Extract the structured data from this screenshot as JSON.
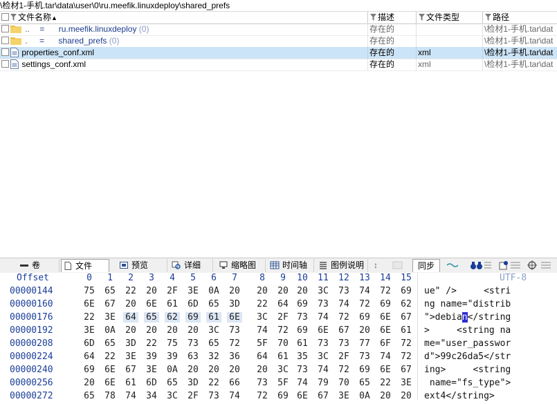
{
  "path_bar": "\\检材1-手机.tar\\data\\user\\0\\ru.meefik.linuxdeploy\\shared_prefs",
  "file_list": {
    "columns": {
      "name": "文件名称",
      "sort_indicator": "▲",
      "desc": "描述",
      "type": "文件类型",
      "path": "路径"
    },
    "rows": [
      {
        "kind": "folder",
        "dots": "..",
        "eq": "=",
        "name": "ru.meefik.linuxdeploy",
        "count": "(0)",
        "desc": "存在的",
        "type": "",
        "path": "\\检材1-手机.tar\\dat",
        "selected": false
      },
      {
        "kind": "folder",
        "dots": ".",
        "eq": "=",
        "name": "shared_prefs",
        "count": "(0)",
        "desc": "存在的",
        "type": "",
        "path": "\\检材1-手机.tar\\dat",
        "selected": false
      },
      {
        "kind": "file",
        "dots": "",
        "eq": "",
        "name": "properties_conf.xml",
        "count": "",
        "desc": "存在的",
        "type": "xml",
        "path": "\\检材1-手机.tar\\dat",
        "selected": true
      },
      {
        "kind": "file",
        "dots": "",
        "eq": "",
        "name": "settings_conf.xml",
        "count": "",
        "desc": "存在的",
        "type": "xml",
        "path": "\\检材1-手机.tar\\dat",
        "selected": false
      }
    ]
  },
  "toolbar": {
    "tabs": [
      {
        "label": "卷",
        "icon": "volume-icon"
      },
      {
        "label": "文件",
        "icon": "file-icon"
      },
      {
        "label": "预览",
        "icon": "preview-icon"
      },
      {
        "label": "详细",
        "icon": "detail-icon"
      },
      {
        "label": "缩略图",
        "icon": "thumbnail-icon"
      },
      {
        "label": "时间轴",
        "icon": "timeline-icon"
      },
      {
        "label": "图例说明",
        "icon": "legend-icon"
      }
    ],
    "sync_label": "同步"
  },
  "hex": {
    "offset_label": "Offset",
    "columns": [
      "0",
      "1",
      "2",
      "3",
      "4",
      "5",
      "6",
      "7",
      "8",
      "9",
      "10",
      "11",
      "12",
      "13",
      "14",
      "15"
    ],
    "encoding": "UTF-8",
    "rows": [
      {
        "offset": "00000144",
        "bytes": [
          "75",
          "65",
          "22",
          "20",
          "2F",
          "3E",
          "0A",
          "20",
          "20",
          "20",
          "20",
          "3C",
          "73",
          "74",
          "72",
          "69"
        ],
        "text": "ue\" />     <stri"
      },
      {
        "offset": "00000160",
        "bytes": [
          "6E",
          "67",
          "20",
          "6E",
          "61",
          "6D",
          "65",
          "3D",
          "22",
          "64",
          "69",
          "73",
          "74",
          "72",
          "69",
          "62"
        ],
        "text": "ng name=\"distrib"
      },
      {
        "offset": "00000176",
        "bytes": [
          "22",
          "3E",
          "64",
          "65",
          "62",
          "69",
          "61",
          "6E",
          "3C",
          "2F",
          "73",
          "74",
          "72",
          "69",
          "6E",
          "67"
        ],
        "text_pre": "\">debia",
        "text_caret": "n",
        "text_post": "</string",
        "highlight": [
          2,
          3,
          4,
          5,
          6,
          7
        ]
      },
      {
        "offset": "00000192",
        "bytes": [
          "3E",
          "0A",
          "20",
          "20",
          "20",
          "20",
          "3C",
          "73",
          "74",
          "72",
          "69",
          "6E",
          "67",
          "20",
          "6E",
          "61"
        ],
        "text": ">     <string na"
      },
      {
        "offset": "00000208",
        "bytes": [
          "6D",
          "65",
          "3D",
          "22",
          "75",
          "73",
          "65",
          "72",
          "5F",
          "70",
          "61",
          "73",
          "73",
          "77",
          "6F",
          "72"
        ],
        "text": "me=\"user_passwor"
      },
      {
        "offset": "00000224",
        "bytes": [
          "64",
          "22",
          "3E",
          "39",
          "39",
          "63",
          "32",
          "36",
          "64",
          "61",
          "35",
          "3C",
          "2F",
          "73",
          "74",
          "72"
        ],
        "text": "d\">99c26da5</str"
      },
      {
        "offset": "00000240",
        "bytes": [
          "69",
          "6E",
          "67",
          "3E",
          "0A",
          "20",
          "20",
          "20",
          "20",
          "3C",
          "73",
          "74",
          "72",
          "69",
          "6E",
          "67"
        ],
        "text": "ing>     <string"
      },
      {
        "offset": "00000256",
        "bytes": [
          "20",
          "6E",
          "61",
          "6D",
          "65",
          "3D",
          "22",
          "66",
          "73",
          "5F",
          "74",
          "79",
          "70",
          "65",
          "22",
          "3E"
        ],
        "text": " name=\"fs_type\">"
      },
      {
        "offset": "00000272",
        "bytes": [
          "65",
          "78",
          "74",
          "34",
          "3C",
          "2F",
          "73",
          "74",
          "72",
          "69",
          "6E",
          "67",
          "3E",
          "0A",
          "20",
          "20"
        ],
        "text": "ext4</string>   "
      }
    ]
  },
  "colors": {
    "selection": "#cce4f7",
    "hex_label": "#1a3d99",
    "byte_highlight": "#dce6f5",
    "caret": "#2b2bd6"
  }
}
